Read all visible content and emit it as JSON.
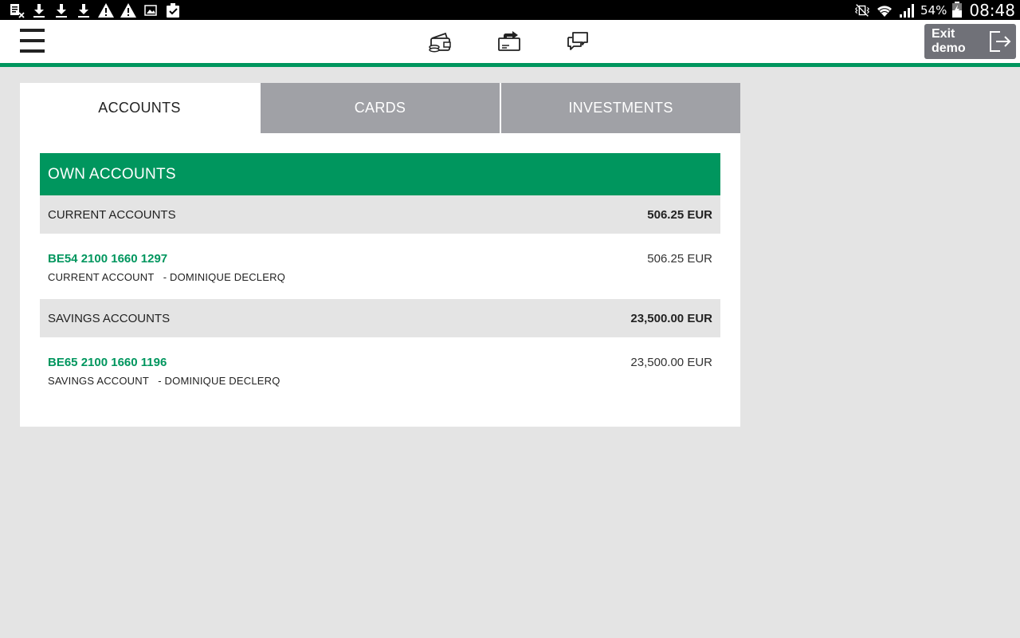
{
  "status_bar": {
    "left_icons": [
      "sim-card-icon",
      "download-icon",
      "download-icon",
      "download-icon",
      "warning-icon",
      "warning-icon",
      "image-icon",
      "clipboard-check-icon"
    ],
    "right_icons": [
      "vibrate-icon",
      "wifi-icon",
      "signal-icon",
      "battery-icon"
    ],
    "battery": "54%",
    "time": "08:48"
  },
  "app_bar": {
    "menu_icon": "hamburger-menu-icon",
    "nav_icons": [
      "wallet-icon",
      "transfer-icon",
      "chat-icon"
    ],
    "exit_label": "Exit\ndemo",
    "exit_icon": "exit-icon",
    "accent_color": "#00965e"
  },
  "tabs": [
    {
      "label": "ACCOUNTS",
      "active": true
    },
    {
      "label": "CARDS",
      "active": false
    },
    {
      "label": "INVESTMENTS",
      "active": false
    }
  ],
  "own_accounts": {
    "title": "OWN ACCOUNTS",
    "groups": [
      {
        "label": "CURRENT ACCOUNTS",
        "total": "506.25 EUR",
        "accounts": [
          {
            "iban": "BE54 2100 1660 1297",
            "description": "CURRENT ACCOUNT   - DOMINIQUE DECLERQ",
            "amount": "506.25 EUR"
          }
        ]
      },
      {
        "label": "SAVINGS ACCOUNTS",
        "total": "23,500.00 EUR",
        "accounts": [
          {
            "iban": "BE65 2100 1660 1196",
            "description": "SAVINGS ACCOUNT   - DOMINIQUE DECLERQ",
            "amount": "23,500.00 EUR"
          }
        ]
      }
    ]
  }
}
